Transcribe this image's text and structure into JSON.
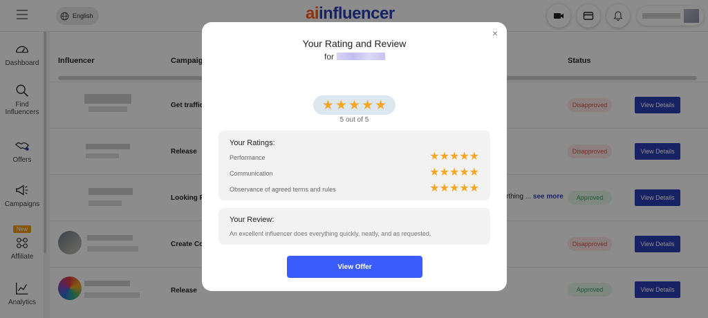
{
  "header": {
    "language_label": "English",
    "logo_prefix": "ai",
    "logo_rest": "influencer"
  },
  "sidebar": {
    "items": [
      {
        "label": "Dashboard",
        "icon": "dashboard-gauge-icon"
      },
      {
        "label": "Find Influencers",
        "icon": "search-icon"
      },
      {
        "label": "Offers",
        "icon": "handshake-icon"
      },
      {
        "label": "Campaigns",
        "icon": "megaphone-icon"
      },
      {
        "label": "Affiliate",
        "icon": "affiliate-network-icon",
        "badge": "New"
      },
      {
        "label": "Analytics",
        "icon": "analytics-chart-icon"
      }
    ]
  },
  "table": {
    "headers": {
      "influencer": "Influencer",
      "campaign": "Campaign",
      "status": "Status"
    },
    "rows": [
      {
        "campaign": "Get traffic",
        "status": "Disapproved",
        "action": "View Details"
      },
      {
        "campaign": "Release",
        "status": "Disapproved",
        "action": "View Details"
      },
      {
        "campaign": "Looking F",
        "status": "Approved",
        "action": "View Details"
      },
      {
        "campaign": "Create Co",
        "status": "Disapproved",
        "action": "View Details"
      },
      {
        "campaign": "Release",
        "status": "Approved",
        "action": "View Details"
      }
    ],
    "truncated_text": "rthing ...",
    "see_more": "see more"
  },
  "modal": {
    "title": "Your Rating and Review",
    "for_label": "for",
    "overall_rating": 5,
    "overall_max": 5,
    "out_of_text": "5 out of 5",
    "ratings_title": "Your Ratings:",
    "ratings": [
      {
        "label": "Performance",
        "value": 5
      },
      {
        "label": "Communication",
        "value": 5
      },
      {
        "label": "Observance of agreed terms and rules",
        "value": 5
      }
    ],
    "review_title": "Your Review:",
    "review_text": "An excellent influencer does everything quickly, neatly, and as requested.",
    "cta_label": "View Offer",
    "close_symbol": "×"
  },
  "colors": {
    "brand_blue": "#2b3fb8",
    "brand_orange": "#ff5a1f",
    "cta_blue": "#3b5bfa",
    "star": "#f5a623",
    "disapproved": "#d9534f",
    "approved": "#3a9d5d"
  }
}
